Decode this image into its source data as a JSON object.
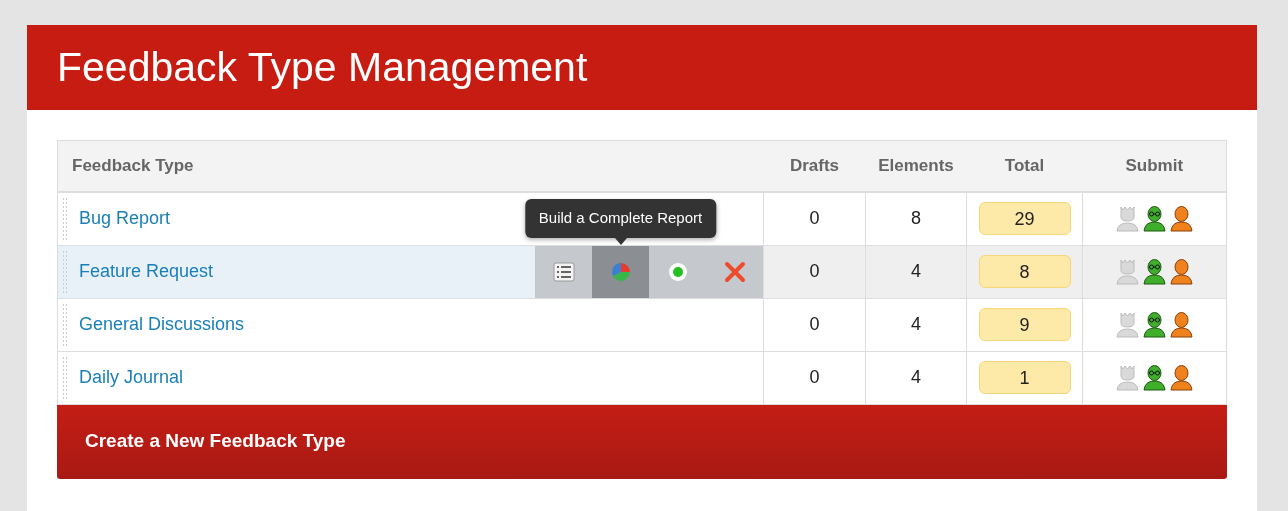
{
  "title": "Feedback Type Management",
  "table": {
    "columns": [
      "Feedback Type",
      "Drafts",
      "Elements",
      "Total",
      "Submit"
    ],
    "rows": [
      {
        "name": "Bug Report",
        "drafts": "0",
        "elements": "8",
        "total": "29",
        "selected": false
      },
      {
        "name": "Feature Request",
        "drafts": "0",
        "elements": "4",
        "total": "8",
        "selected": true
      },
      {
        "name": "General Discussions",
        "drafts": "0",
        "elements": "4",
        "total": "9",
        "selected": false
      },
      {
        "name": "Daily Journal",
        "drafts": "0",
        "elements": "4",
        "total": "1",
        "selected": false
      }
    ]
  },
  "row_actions": [
    {
      "kind": "list",
      "hovered": false
    },
    {
      "kind": "chart",
      "hovered": true,
      "tooltip": "Build a Complete Report"
    },
    {
      "kind": "status",
      "hovered": false
    },
    {
      "kind": "delete",
      "hovered": false
    }
  ],
  "create_button": "Create a New Feedback Type"
}
